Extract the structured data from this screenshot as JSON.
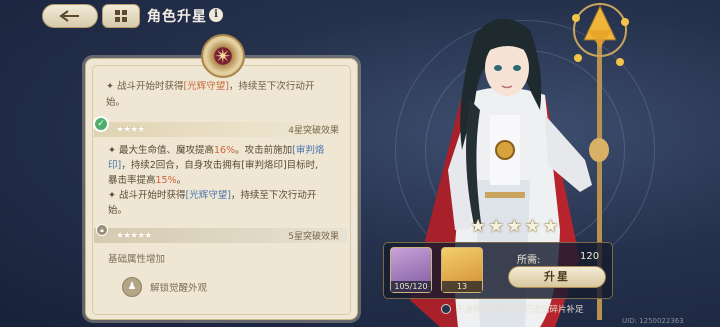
{
  "header": {
    "title": "角色升星",
    "info_glyph": "i"
  },
  "panel": {
    "top_fragment_line1_pre": "✦ 战斗开始时获得",
    "top_fragment_line1_hl": "[光辉守望]",
    "top_fragment_line1_post": "，持续至下次行动开",
    "top_fragment_line2": "始。",
    "section1": {
      "label": "4星突破效果",
      "lines": [
        {
          "parts": [
            {
              "t": "✦ 最大生命值、魔攻提高",
              "c": ""
            },
            {
              "t": "16%",
              "c": "hl"
            },
            {
              "t": "。攻击前施加",
              "c": ""
            },
            {
              "t": "[审判烙",
              "c": "bl"
            }
          ]
        },
        {
          "parts": [
            {
              "t": "印]",
              "c": "bl"
            },
            {
              "t": "，持续2回合，自身攻击拥有[审判烙印]目标时,",
              "c": ""
            }
          ]
        },
        {
          "parts": [
            {
              "t": "暴击率提高",
              "c": ""
            },
            {
              "t": "15%",
              "c": "hl"
            },
            {
              "t": "。",
              "c": ""
            }
          ]
        },
        {
          "parts": [
            {
              "t": "✦ 战斗开始时获得",
              "c": ""
            },
            {
              "t": "[光辉守望]",
              "c": "bl"
            },
            {
              "t": "，持续至下次行动开",
              "c": ""
            }
          ]
        },
        {
          "parts": [
            {
              "t": "始。",
              "c": ""
            }
          ]
        }
      ]
    },
    "section2": {
      "label": "5星突破效果",
      "base_text": "基础属性增加"
    },
    "unlock_text": "解锁觉醒外观"
  },
  "upgrade": {
    "item1_count": "105/120",
    "item2_count": "13",
    "required_label": "所需:",
    "required_value": "120",
    "button_label": "升星",
    "option_text": "不消耗是否使用不朽追忆碎片补足"
  },
  "uid_text": "UID: 1250022363",
  "star_count": 5,
  "colors": {
    "accent": "#c9a45c",
    "panel": "#efe7d3",
    "highlight": "#d2633a",
    "link": "#4a74b0"
  }
}
